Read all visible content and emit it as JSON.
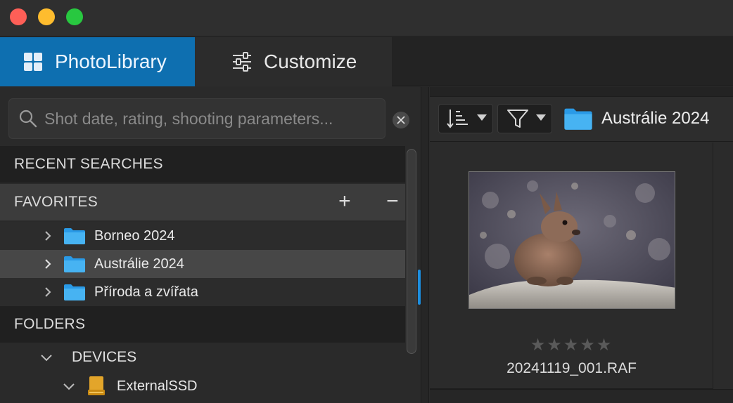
{
  "window": {
    "controls": [
      "close",
      "minimize",
      "maximize"
    ],
    "colors": {
      "close": "#fe5f57",
      "minimize": "#febc2e",
      "maximize": "#28c840"
    }
  },
  "tabs": [
    {
      "label": "PhotoLibrary",
      "icon": "grid-icon",
      "active": true
    },
    {
      "label": "Customize",
      "icon": "sliders-icon",
      "active": false
    }
  ],
  "accent_color": "#0e6fb0",
  "search": {
    "placeholder": "Shot date, rating, shooting parameters...",
    "value": ""
  },
  "sidebar": {
    "recent_searches_label": "RECENT SEARCHES",
    "favorites_label": "FAVORITES",
    "favorites_add": "+",
    "favorites_remove": "−",
    "favorites": [
      {
        "label": "Borneo 2024",
        "icon": "folder-icon",
        "selected": false
      },
      {
        "label": "Austrálie 2024",
        "icon": "folder-icon",
        "selected": true
      },
      {
        "label": "Příroda a zvířata",
        "icon": "folder-icon",
        "selected": false
      }
    ],
    "folders_label": "FOLDERS",
    "devices_label": "DEVICES",
    "drive_label": "ExternalSSD"
  },
  "browser": {
    "current_folder": "Austrálie 2024",
    "sort_icon": "sort-icon",
    "filter_icon": "filter-icon",
    "items": [
      {
        "filename": "20241119_001.RAF",
        "rating": 0,
        "max_rating": 5,
        "stars": "★★★★★"
      }
    ]
  }
}
